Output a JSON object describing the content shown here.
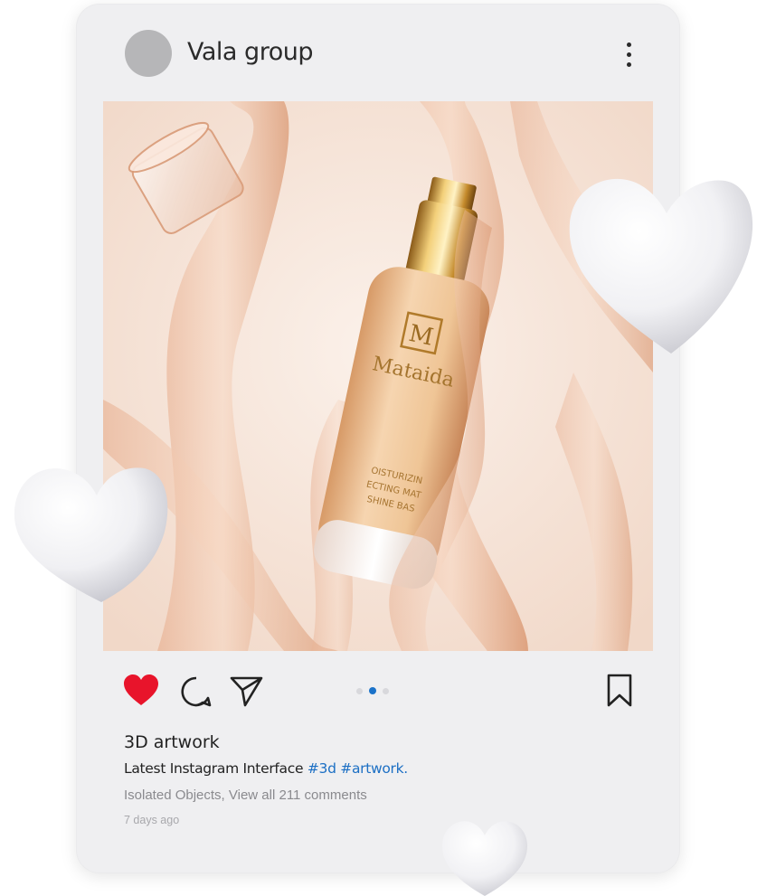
{
  "post": {
    "username": "Vala group",
    "title": "3D artwork",
    "caption_text": "Latest Instagram Interface ",
    "caption_tags": "#3d #artwork.",
    "comments_text": "Isolated Objects, View all 211 comments",
    "timestamp": "7 days ago",
    "liked": true,
    "carousel": {
      "count": 3,
      "active_index": 1
    }
  },
  "product": {
    "brand_letter": "M",
    "brand_name": "Mataida",
    "label_line1": "OISTURIZIN",
    "label_line2": "ECTING MAT",
    "label_line3": "SHINE BAS"
  },
  "icons": {
    "like": "heart-icon",
    "comment": "comment-icon",
    "share": "send-icon",
    "save": "bookmark-icon",
    "more": "more-vertical-icon"
  },
  "colors": {
    "like_red": "#e8142b",
    "tag_blue": "#1c6fc4",
    "active_dot": "#1b72c9",
    "card_bg": "#efeff1"
  }
}
